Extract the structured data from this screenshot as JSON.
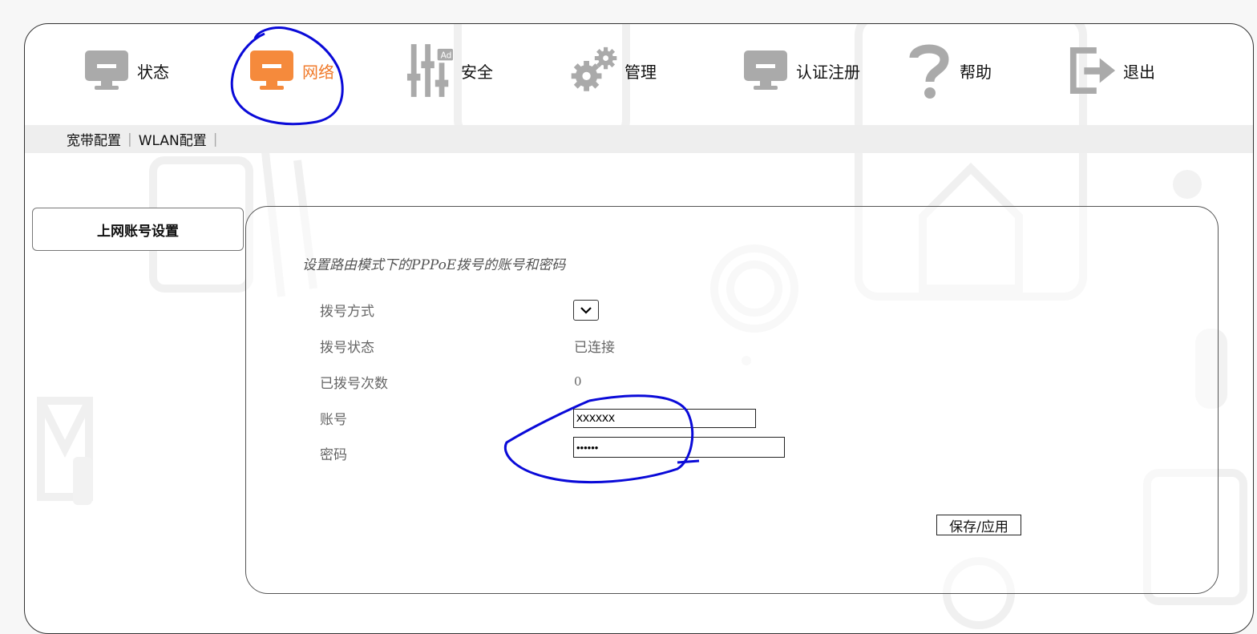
{
  "nav": {
    "items": [
      {
        "label": "状态",
        "icon": "monitor-icon"
      },
      {
        "label": "网络",
        "icon": "monitor-icon",
        "active": true
      },
      {
        "label": "安全",
        "icon": "sliders-icon"
      },
      {
        "label": "管理",
        "icon": "gears-icon"
      },
      {
        "label": "认证注册",
        "icon": "monitor-icon"
      },
      {
        "label": "帮助",
        "icon": "question-icon"
      },
      {
        "label": "退出",
        "icon": "logout-icon"
      }
    ]
  },
  "subnav": {
    "items": [
      {
        "label": "宽带配置"
      },
      {
        "label": "WLAN配置"
      }
    ],
    "separator": "|"
  },
  "sidebar": {
    "label": "上网账号设置"
  },
  "form": {
    "description": "设置路由模式下的PPPoE拨号的账号和密码",
    "dial_mode_label": "拨号方式",
    "dial_status_label": "拨号状态",
    "dial_status_value": "已连接",
    "dial_count_label": "已拨号次数",
    "dial_count_value": "0",
    "account_label": "账号",
    "account_value": "xxxxxx",
    "password_label": "密码",
    "password_value": "••••••",
    "save_label": "保存/应用"
  },
  "colors": {
    "accent": "#f07a2a",
    "icon_gray": "#aaaaaa",
    "annotation": "#0a0ad8"
  }
}
